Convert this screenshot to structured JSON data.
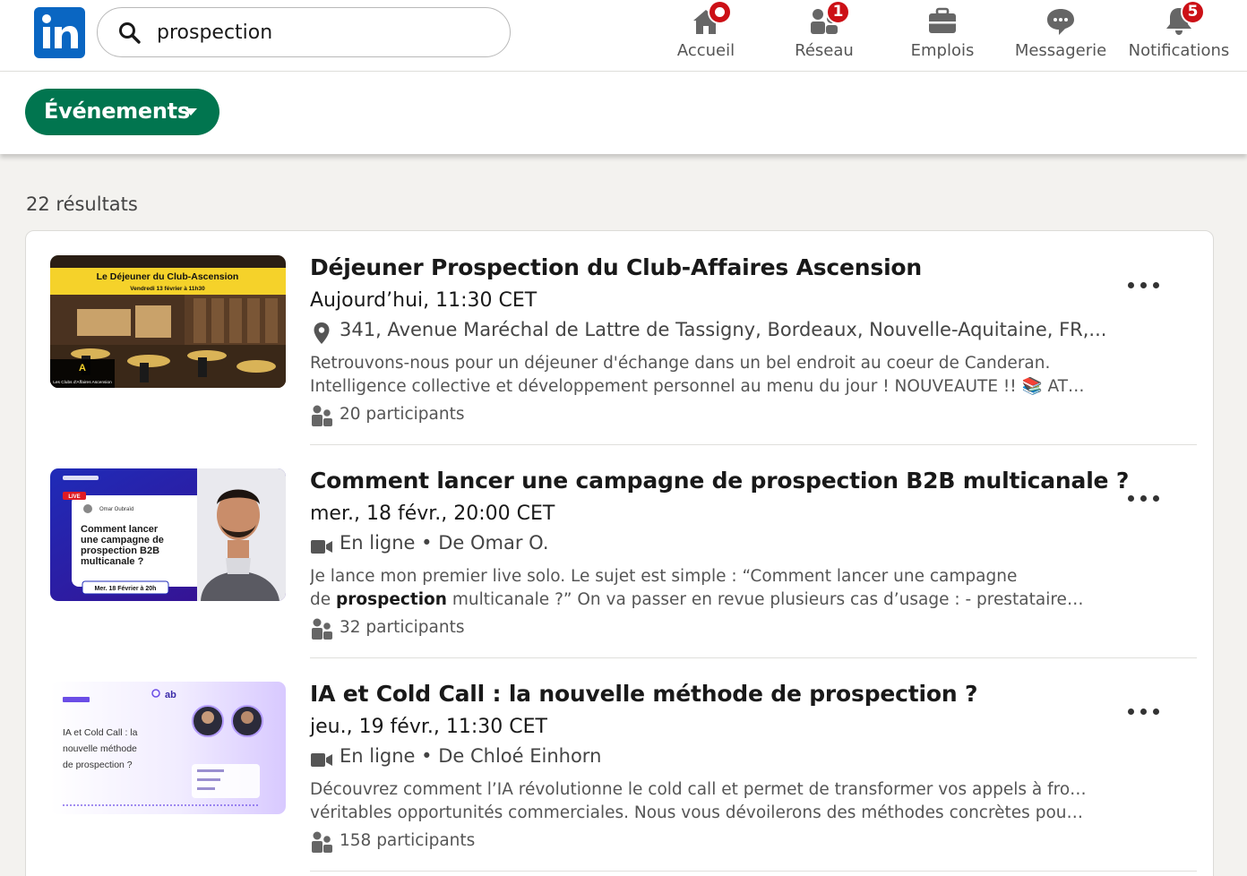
{
  "search": {
    "value": "prospection",
    "icon": "search-icon"
  },
  "nav": {
    "items": [
      {
        "label": "Accueil",
        "icon": "home-icon",
        "badge": ""
      },
      {
        "label": "Réseau",
        "icon": "network-icon",
        "badge": "1"
      },
      {
        "label": "Emplois",
        "icon": "briefcase-icon",
        "badge": ""
      },
      {
        "label": "Messagerie",
        "icon": "messaging-icon",
        "badge": ""
      },
      {
        "label": "Notifications",
        "icon": "bell-icon",
        "badge": "5"
      }
    ]
  },
  "filter": {
    "label": "Événements"
  },
  "results": {
    "count_label": "22 résultats",
    "items": [
      {
        "title": "Déjeuner Prospection du Club-Affaires Ascension",
        "date": "Aujourd’hui, 11:30 CET",
        "meta": "341, Avenue Maréchal de Lattre de Tassigny, Bordeaux, Nouvelle-Aquitaine, FR,...",
        "meta_icon": "location-pin-icon",
        "desc_line1": "Retrouvons-nous pour un déjeuner d'échange dans un bel endroit au coeur de Canderan.",
        "desc_line2": "Intelligence collective et développement personnel au menu du jour ! NOUVEAUTE !! 📚 ATELIER...",
        "attendees": "20 participants",
        "thumb": {
          "banner_title": "Le Déjeuner du Club-Ascension",
          "banner_subtitle": "Vendredi 13 février à 11h30",
          "logo_text": "Les Clubs d'Affaires Ascension"
        }
      },
      {
        "title": "Comment lancer une campagne de prospection B2B multicanale ?",
        "date": "mer., 18 févr., 20:00 CET",
        "meta": "En ligne • De Omar O.",
        "meta_icon": "video-camera-icon",
        "desc_line1": "Je lance mon premier live solo. Le sujet est simple : “Comment lancer une campagne",
        "desc_line2_pre": "de ",
        "desc_line2_bold": "prospection",
        "desc_line2_post": " multicanale ?” On va passer en revue plusieurs cas d’usage : - prestataires de...",
        "attendees": "32 participants",
        "thumb": {
          "live_label": "LIVE",
          "host": "Omar Oubraïd",
          "headline_1": "Comment lancer",
          "headline_2": "une campagne de",
          "headline_3": "prospection B2B",
          "headline_4": "multicanale ?",
          "date_chip": "Mer. 18 Février à 20h"
        }
      },
      {
        "title": "IA et Cold Call : la nouvelle méthode de prospection ?",
        "date": "jeu., 19 févr., 11:30 CET",
        "meta": "En ligne • De Chloé Einhorn",
        "meta_icon": "video-camera-icon",
        "desc_line1": "Découvrez comment l’IA révolutionne le cold call et permet de transformer vos appels à froid en",
        "desc_line2": "véritables opportunités commerciales. Nous vous dévoilerons des méthodes concrètes pour mieu...",
        "attendees": "158 participants",
        "thumb": {
          "brand": "ab",
          "line_1": "IA et Cold Call : la",
          "line_2": "nouvelle méthode",
          "line_3": "de prospection ?"
        }
      }
    ]
  },
  "colors": {
    "brand": "#0a66c2",
    "filter_green": "#01754f",
    "badge_red": "#cc1016"
  }
}
